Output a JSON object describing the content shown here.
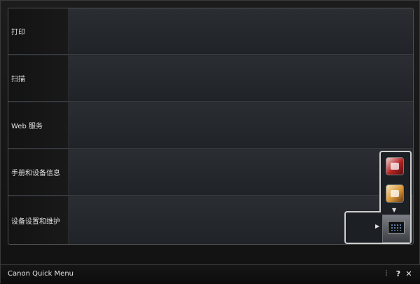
{
  "menu": {
    "items": [
      {
        "label": "打印"
      },
      {
        "label": "扫描"
      },
      {
        "label": "Web 服务"
      },
      {
        "label": "手册和设备信息"
      },
      {
        "label": "设备设置和维护"
      }
    ]
  },
  "popup": {
    "icons": [
      "photo-print-icon",
      "creative-print-icon",
      "device-icon"
    ],
    "down_arrow": "▼",
    "right_arrow": "▶"
  },
  "statusbar": {
    "title": "Canon Quick Menu",
    "settings_glyph": "⫶",
    "help_glyph": "?",
    "close_glyph": "✕"
  }
}
